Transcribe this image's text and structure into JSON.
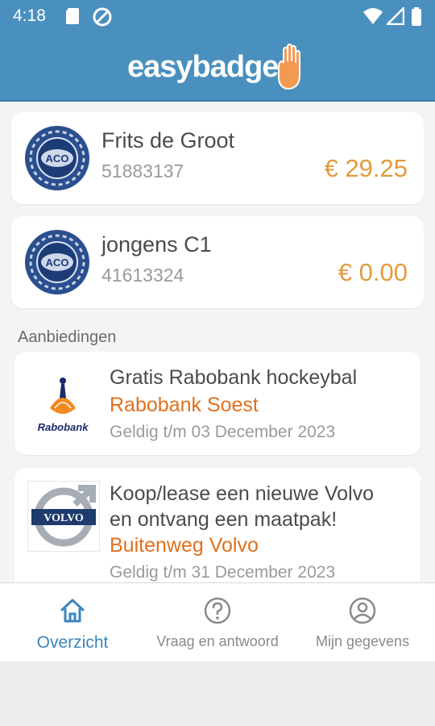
{
  "status_bar": {
    "time": "4:18"
  },
  "app": {
    "logo_text": "easybadge"
  },
  "members": [
    {
      "name": "Frits de Groot",
      "number": "51883137",
      "balance": "€ 29.25",
      "badge_text": "ACO"
    },
    {
      "name": "jongens C1",
      "number": "41613324",
      "balance": "€ 0.00",
      "badge_text": "ACO"
    }
  ],
  "offers_section": {
    "title": "Aanbiedingen"
  },
  "offers": [
    {
      "title_lines": [
        "Gratis Rabobank hockeybal"
      ],
      "vendor": "Rabobank Soest",
      "valid": "Geldig t/m 03 December 2023",
      "logo": "Rabobank"
    },
    {
      "title_lines": [
        "Koop/lease een nieuwe Volvo",
        "en ontvang een maatpak!"
      ],
      "vendor": "Buitenweg Volvo",
      "valid": "Geldig t/m 31 December 2023",
      "logo": "VOLVO"
    }
  ],
  "nav": [
    {
      "label": "Overzicht",
      "icon": "home-icon",
      "active": true
    },
    {
      "label": "Vraag en antwoord",
      "icon": "question-circle-icon",
      "active": false
    },
    {
      "label": "Mijn gegevens",
      "icon": "user-circle-icon",
      "active": false
    }
  ],
  "colors": {
    "header": "#4a90bf",
    "amount": "#e39a3c",
    "vendor": "#e0701f",
    "nav_active": "#3b86bd"
  }
}
